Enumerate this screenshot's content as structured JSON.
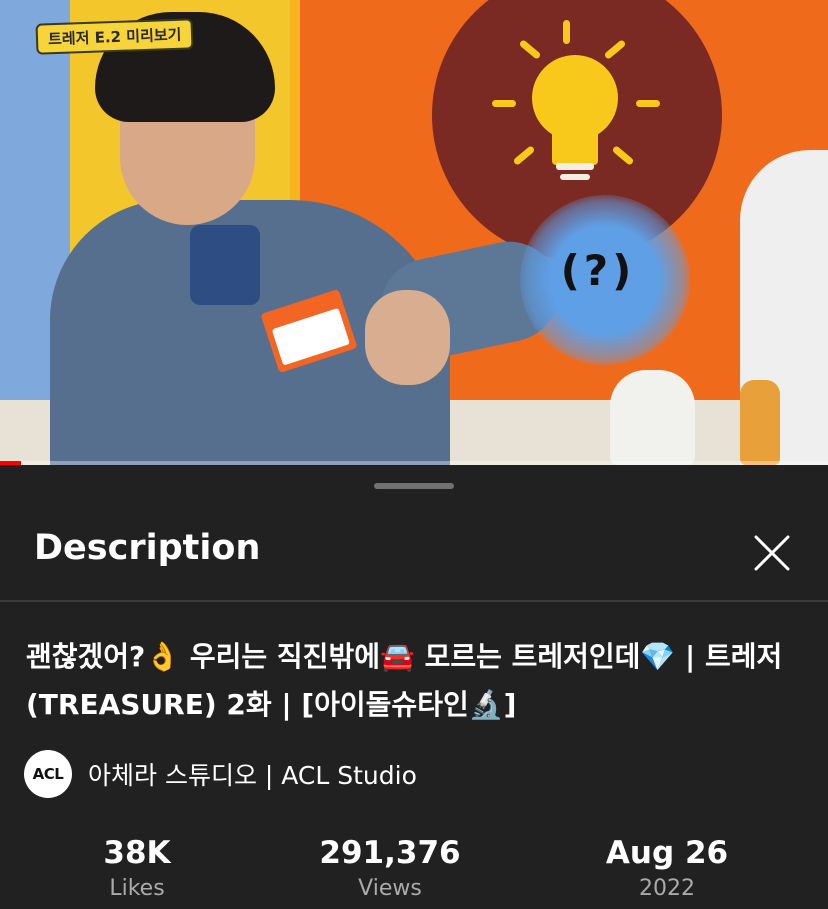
{
  "video": {
    "caption_tag": "트레저 E.2 미리보기",
    "bubble_text": "(?)",
    "progress": 0.025
  },
  "sheet": {
    "title": "Description",
    "close_icon": "close-icon"
  },
  "video_info": {
    "title": "괜찮겠어?👌 우리는 직진밖에🚘 모르는 트레저인데💎 | 트레저(TREASURE) 2화 | [아이돌슈타인🔬]",
    "channel": {
      "avatar_text": "ACL",
      "name": "아체라 스튜디오 | ACL Studio"
    }
  },
  "stats": {
    "likes": {
      "value": "38K",
      "label": "Likes"
    },
    "views": {
      "value": "291,376",
      "label": "Views"
    },
    "date": {
      "value": "Aug 26",
      "label": "2022"
    }
  },
  "colors": {
    "sheet_bg": "#212121",
    "text_primary": "#ffffff",
    "text_secondary": "#aaaaaa",
    "progress_red": "#ff0000"
  }
}
